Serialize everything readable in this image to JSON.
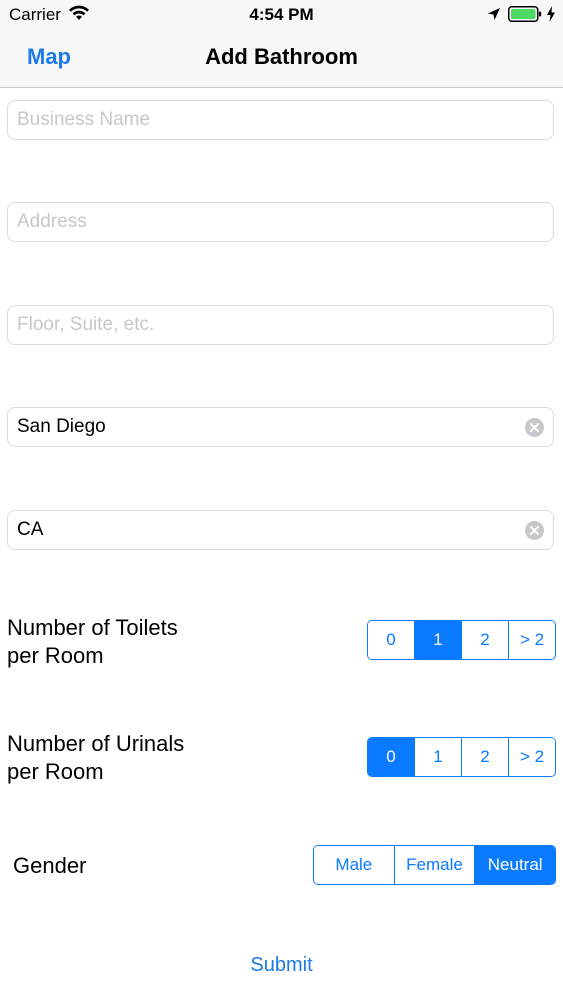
{
  "status_bar": {
    "carrier": "Carrier",
    "time": "4:54 PM",
    "icons": [
      "wifi-icon",
      "location-arrow-icon",
      "battery-icon",
      "charging-bolt-icon"
    ],
    "battery_color": "#4cd964"
  },
  "nav": {
    "back_label": "Map",
    "title": "Add Bathroom",
    "accent": "#1b7ae6"
  },
  "form": {
    "business_name": {
      "placeholder": "Business Name",
      "value": ""
    },
    "address": {
      "placeholder": "Address",
      "value": ""
    },
    "floor": {
      "placeholder": "Floor, Suite, etc.",
      "value": ""
    },
    "city": {
      "placeholder": "",
      "value": "San Diego"
    },
    "state": {
      "placeholder": "",
      "value": "CA"
    },
    "toilets": {
      "label_line1": "Number of Toilets",
      "label_line2": "per Room",
      "options": [
        "0",
        "1",
        "2",
        "> 2"
      ],
      "selected": "1"
    },
    "urinals": {
      "label_line1": "Number of Urinals",
      "label_line2": "per Room",
      "options": [
        "0",
        "1",
        "2",
        "> 2"
      ],
      "selected": "0"
    },
    "gender": {
      "label": "Gender",
      "options": [
        "Male",
        "Female",
        "Neutral"
      ],
      "selected": "Neutral"
    },
    "submit_label": "Submit"
  },
  "colors": {
    "segment_accent": "#0a7aff",
    "placeholder": "#c7c7cd"
  }
}
